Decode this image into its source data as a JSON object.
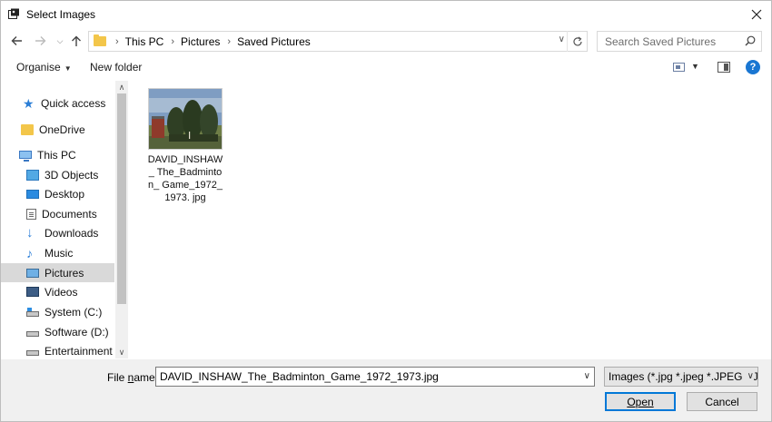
{
  "window": {
    "title": "Select Images"
  },
  "nav": {
    "breadcrumbs": [
      "This PC",
      "Pictures",
      "Saved Pictures"
    ],
    "search_placeholder": "Search Saved Pictures"
  },
  "commands": {
    "organise": "Organise",
    "new_folder": "New folder",
    "help": "?"
  },
  "sidebar": {
    "items": [
      {
        "label": "Quick access",
        "icon": "star-icon"
      },
      {
        "label": "OneDrive",
        "icon": "onedrive-folder-icon"
      },
      {
        "label": "This PC",
        "icon": "computer-icon"
      },
      {
        "label": "3D Objects",
        "icon": "3d-objects-icon"
      },
      {
        "label": "Desktop",
        "icon": "desktop-icon"
      },
      {
        "label": "Documents",
        "icon": "documents-icon"
      },
      {
        "label": "Downloads",
        "icon": "download-arrow-icon"
      },
      {
        "label": "Music",
        "icon": "music-note-icon"
      },
      {
        "label": "Pictures",
        "icon": "pictures-icon",
        "selected": true
      },
      {
        "label": "Videos",
        "icon": "videos-icon"
      },
      {
        "label": "System (C:)",
        "icon": "system-drive-icon"
      },
      {
        "label": "Software (D:)",
        "icon": "drive-icon"
      },
      {
        "label": "Entertainment (E",
        "icon": "drive-icon"
      }
    ]
  },
  "files": [
    {
      "name": "DAVID_INSHAW_ The_Badminton_ Game_1972_1973. jpg"
    }
  ],
  "footer": {
    "file_name_label": "File name:",
    "file_name_value": "DAVID_INSHAW_The_Badminton_Game_1972_1973.jpg",
    "filter": "Images (*.jpg *.jpeg *.JPEG *.JP",
    "open_label": "Open",
    "cancel_label": "Cancel"
  },
  "colors": {
    "accent": "#0078d7",
    "selection": "#d9d9d9",
    "footer_bg": "#f0f0f0"
  }
}
